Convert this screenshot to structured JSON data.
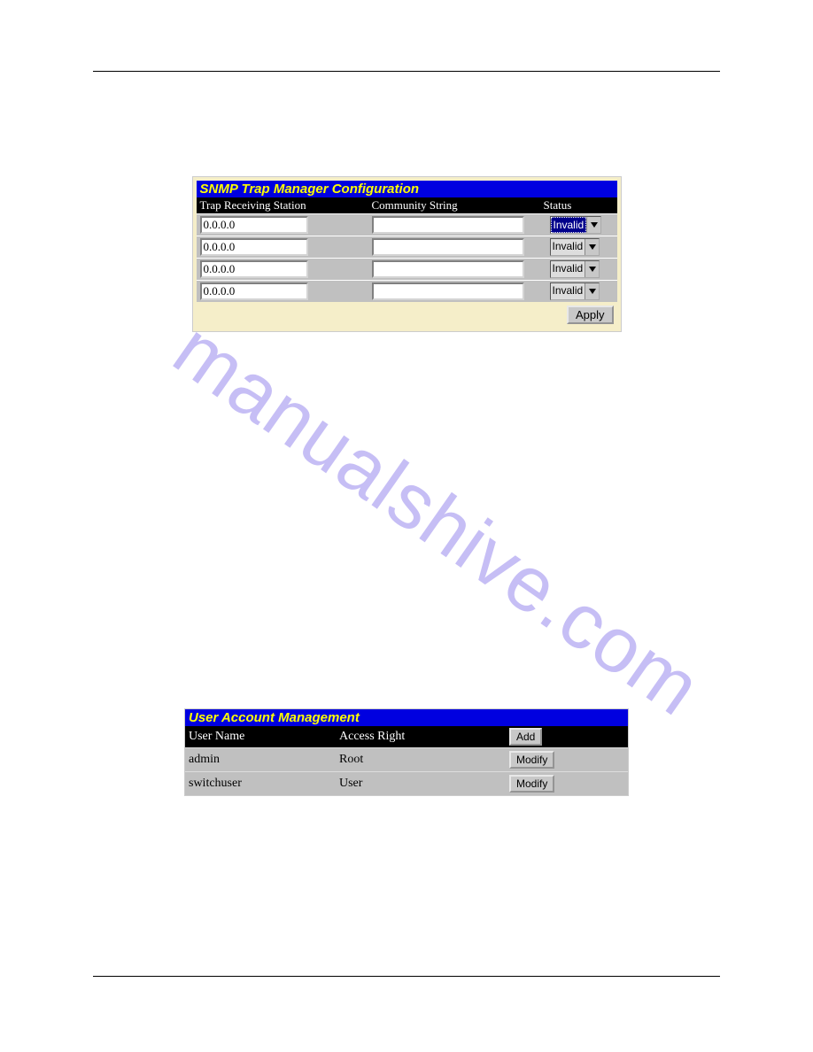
{
  "watermark": "manualshive.com",
  "snmp": {
    "title": "SNMP Trap Manager Configuration",
    "headers": {
      "station": "Trap Receiving Station",
      "community": "Community String",
      "status": "Status"
    },
    "status_option": "Invalid",
    "rows": [
      {
        "ip": "0.0.0.0",
        "community": "",
        "status": "Invalid",
        "selected": true
      },
      {
        "ip": "0.0.0.0",
        "community": "",
        "status": "Invalid",
        "selected": false
      },
      {
        "ip": "0.0.0.0",
        "community": "",
        "status": "Invalid",
        "selected": false
      },
      {
        "ip": "0.0.0.0",
        "community": "",
        "status": "Invalid",
        "selected": false
      }
    ],
    "apply_label": "Apply"
  },
  "users": {
    "title": "User Account Management",
    "headers": {
      "name": "User Name",
      "access": "Access Right"
    },
    "add_label": "Add",
    "modify_label": "Modify",
    "rows": [
      {
        "name": "admin",
        "access": "Root"
      },
      {
        "name": "switchuser",
        "access": "User"
      }
    ]
  }
}
